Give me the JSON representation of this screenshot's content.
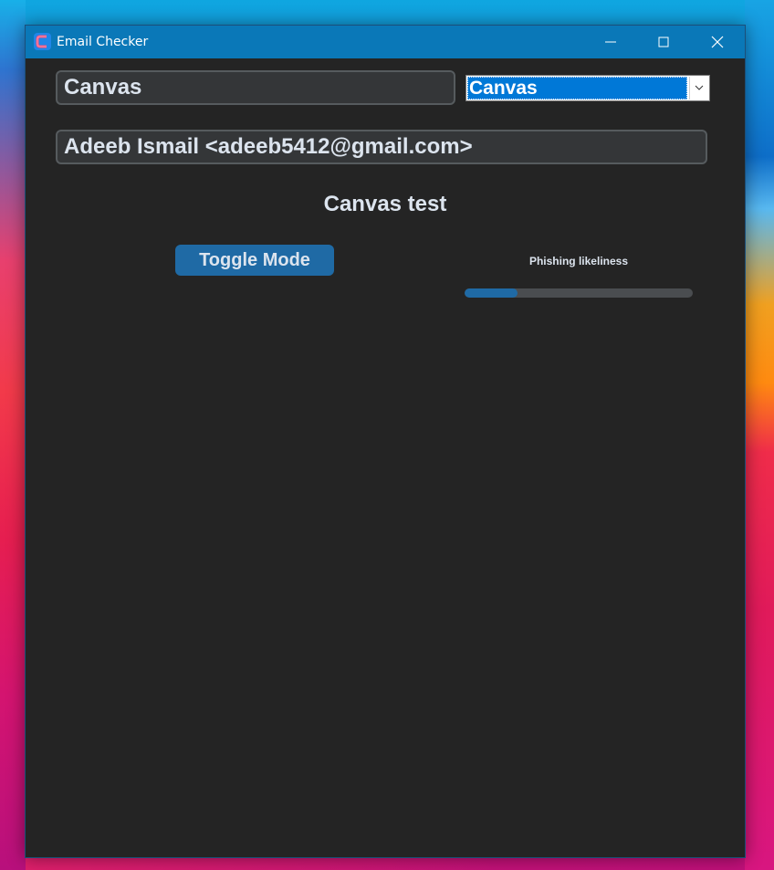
{
  "window": {
    "title": "Email Checker",
    "app_icon": "app-icon"
  },
  "subject_field": {
    "value": "Canvas"
  },
  "platform_select": {
    "selected": "Canvas"
  },
  "sender_field": {
    "value": "Adeeb Ismail <adeeb5412@gmail.com>"
  },
  "heading": "Canvas test",
  "toggle_button": {
    "label": "Toggle Mode"
  },
  "progress": {
    "label": "Phishing likeliness",
    "value": 0.23
  },
  "colors": {
    "accent": "#1f6aa5",
    "background": "#242424",
    "field": "#343638",
    "text": "#dce4ee",
    "titlebar": "#0a78b8"
  }
}
